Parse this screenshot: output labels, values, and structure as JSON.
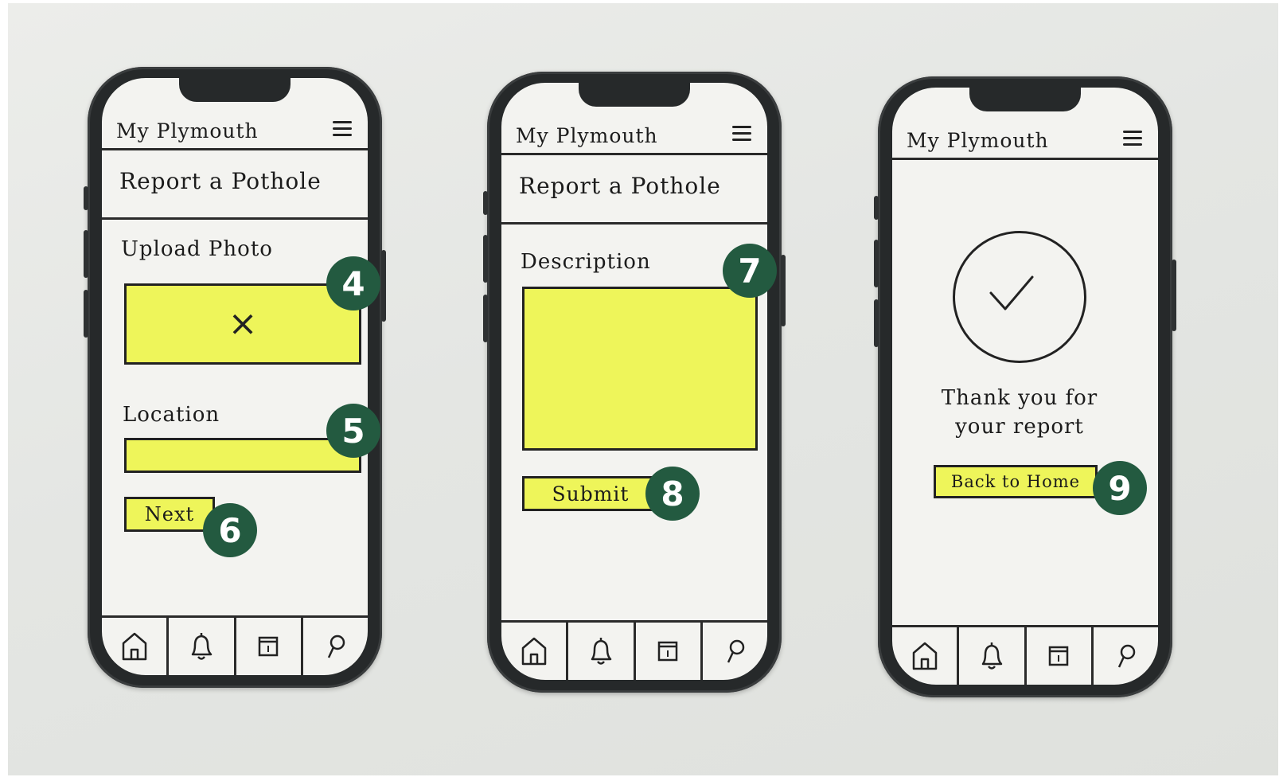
{
  "colors": {
    "highlight": "#eef55a",
    "badge": "#235a40",
    "phone_frame": "#26292a",
    "screen": "#f3f3f0"
  },
  "icons": {
    "menu": "hamburger-menu-icon",
    "home": "home-icon",
    "notifications": "bell-icon",
    "calendar": "calendar-icon",
    "map": "map-pin-icon",
    "upload": "x-placeholder-icon",
    "success": "checkmark-icon"
  },
  "screens": [
    {
      "app_title": "My Plymouth",
      "page_title": "Report a Pothole",
      "upload_label": "Upload Photo",
      "upload_placeholder": "×",
      "location_label": "Location",
      "next_button": "Next",
      "badges": [
        "4",
        "5",
        "6"
      ]
    },
    {
      "app_title": "My Plymouth",
      "page_title": "Report a Pothole",
      "description_label": "Description",
      "submit_button": "Submit",
      "badges": [
        "7",
        "8"
      ]
    },
    {
      "app_title": "My Plymouth",
      "thanks_line1": "Thank you for",
      "thanks_line2": "your report",
      "home_button": "Back to Home",
      "badges": [
        "9"
      ]
    }
  ]
}
